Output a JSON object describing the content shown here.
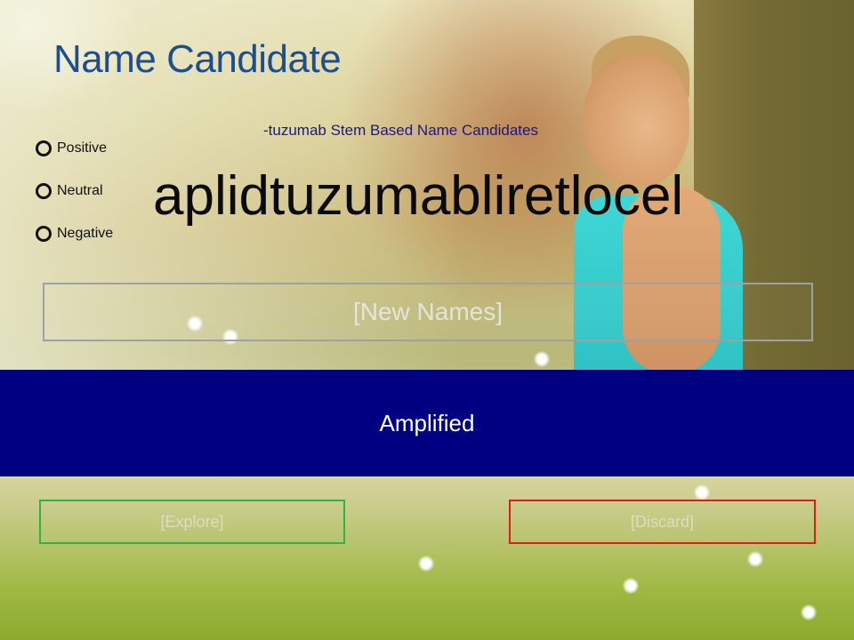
{
  "title": "Name Candidate",
  "sentiment_options": [
    {
      "label": "Positive"
    },
    {
      "label": "Neutral"
    },
    {
      "label": "Negative"
    }
  ],
  "stem_subtitle": "-tuzumab Stem Based Name Candidates",
  "candidate_name": "aplidtuzumabliretlocel",
  "new_names_label": "[New Names]",
  "banner_text": "Amplified",
  "buttons": {
    "explore_label": "[Explore]",
    "discard_label": "[Discard]"
  },
  "colors": {
    "title": "#1f4e8c",
    "banner": "#000080",
    "explore_border": "#2db34a",
    "discard_border": "#e01b1b"
  }
}
